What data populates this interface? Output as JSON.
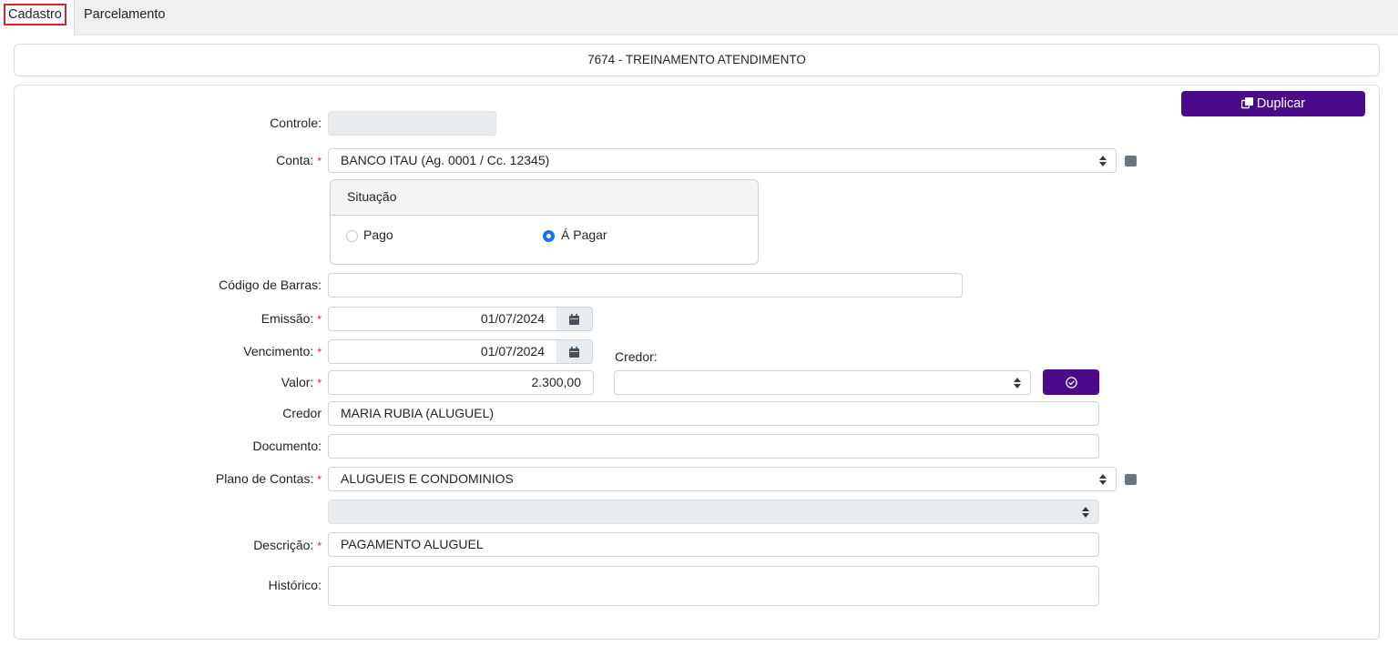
{
  "tabs": [
    {
      "label": "Cadastro",
      "active": true
    },
    {
      "label": "Parcelamento",
      "active": false
    }
  ],
  "title": "7674 - TREINAMENTO ATENDIMENTO",
  "duplicate_button": {
    "label": "Duplicar",
    "icon": "copy-icon"
  },
  "form": {
    "controle": {
      "label": "Controle:",
      "value": ""
    },
    "conta": {
      "label": "Conta:",
      "value": "BANCO ITAU (Ag. 0001 / Cc. 12345)"
    },
    "situacao": {
      "title": "Situação",
      "options": [
        {
          "label": "Pago",
          "checked": false
        },
        {
          "label": "Á Pagar",
          "checked": true
        }
      ]
    },
    "codigo_barras": {
      "label": "Código de Barras:",
      "value": ""
    },
    "emissao": {
      "label": "Emissão:",
      "value": "01/07/2024"
    },
    "vencimento": {
      "label": "Vencimento:",
      "value": "01/07/2024"
    },
    "valor": {
      "label": "Valor:",
      "value": "2.300,00"
    },
    "credor_select": {
      "label": "Credor:",
      "value": ""
    },
    "credor": {
      "label": "Credor",
      "value": "MARIA RUBIA (ALUGUEL)"
    },
    "documento": {
      "label": "Documento:",
      "value": ""
    },
    "plano_contas": {
      "label": "Plano de Contas:",
      "value": "ALUGUEIS E CONDOMINIOS",
      "sub_value": ""
    },
    "descricao": {
      "label": "Descrição:",
      "value": "PAGAMENTO ALUGUEL"
    },
    "historico": {
      "label": "Histórico:",
      "value": ""
    },
    "required_mark": "*"
  },
  "colors": {
    "accent": "#4b0a8a",
    "required": "#d9232d",
    "radio": "#1a73e8"
  }
}
